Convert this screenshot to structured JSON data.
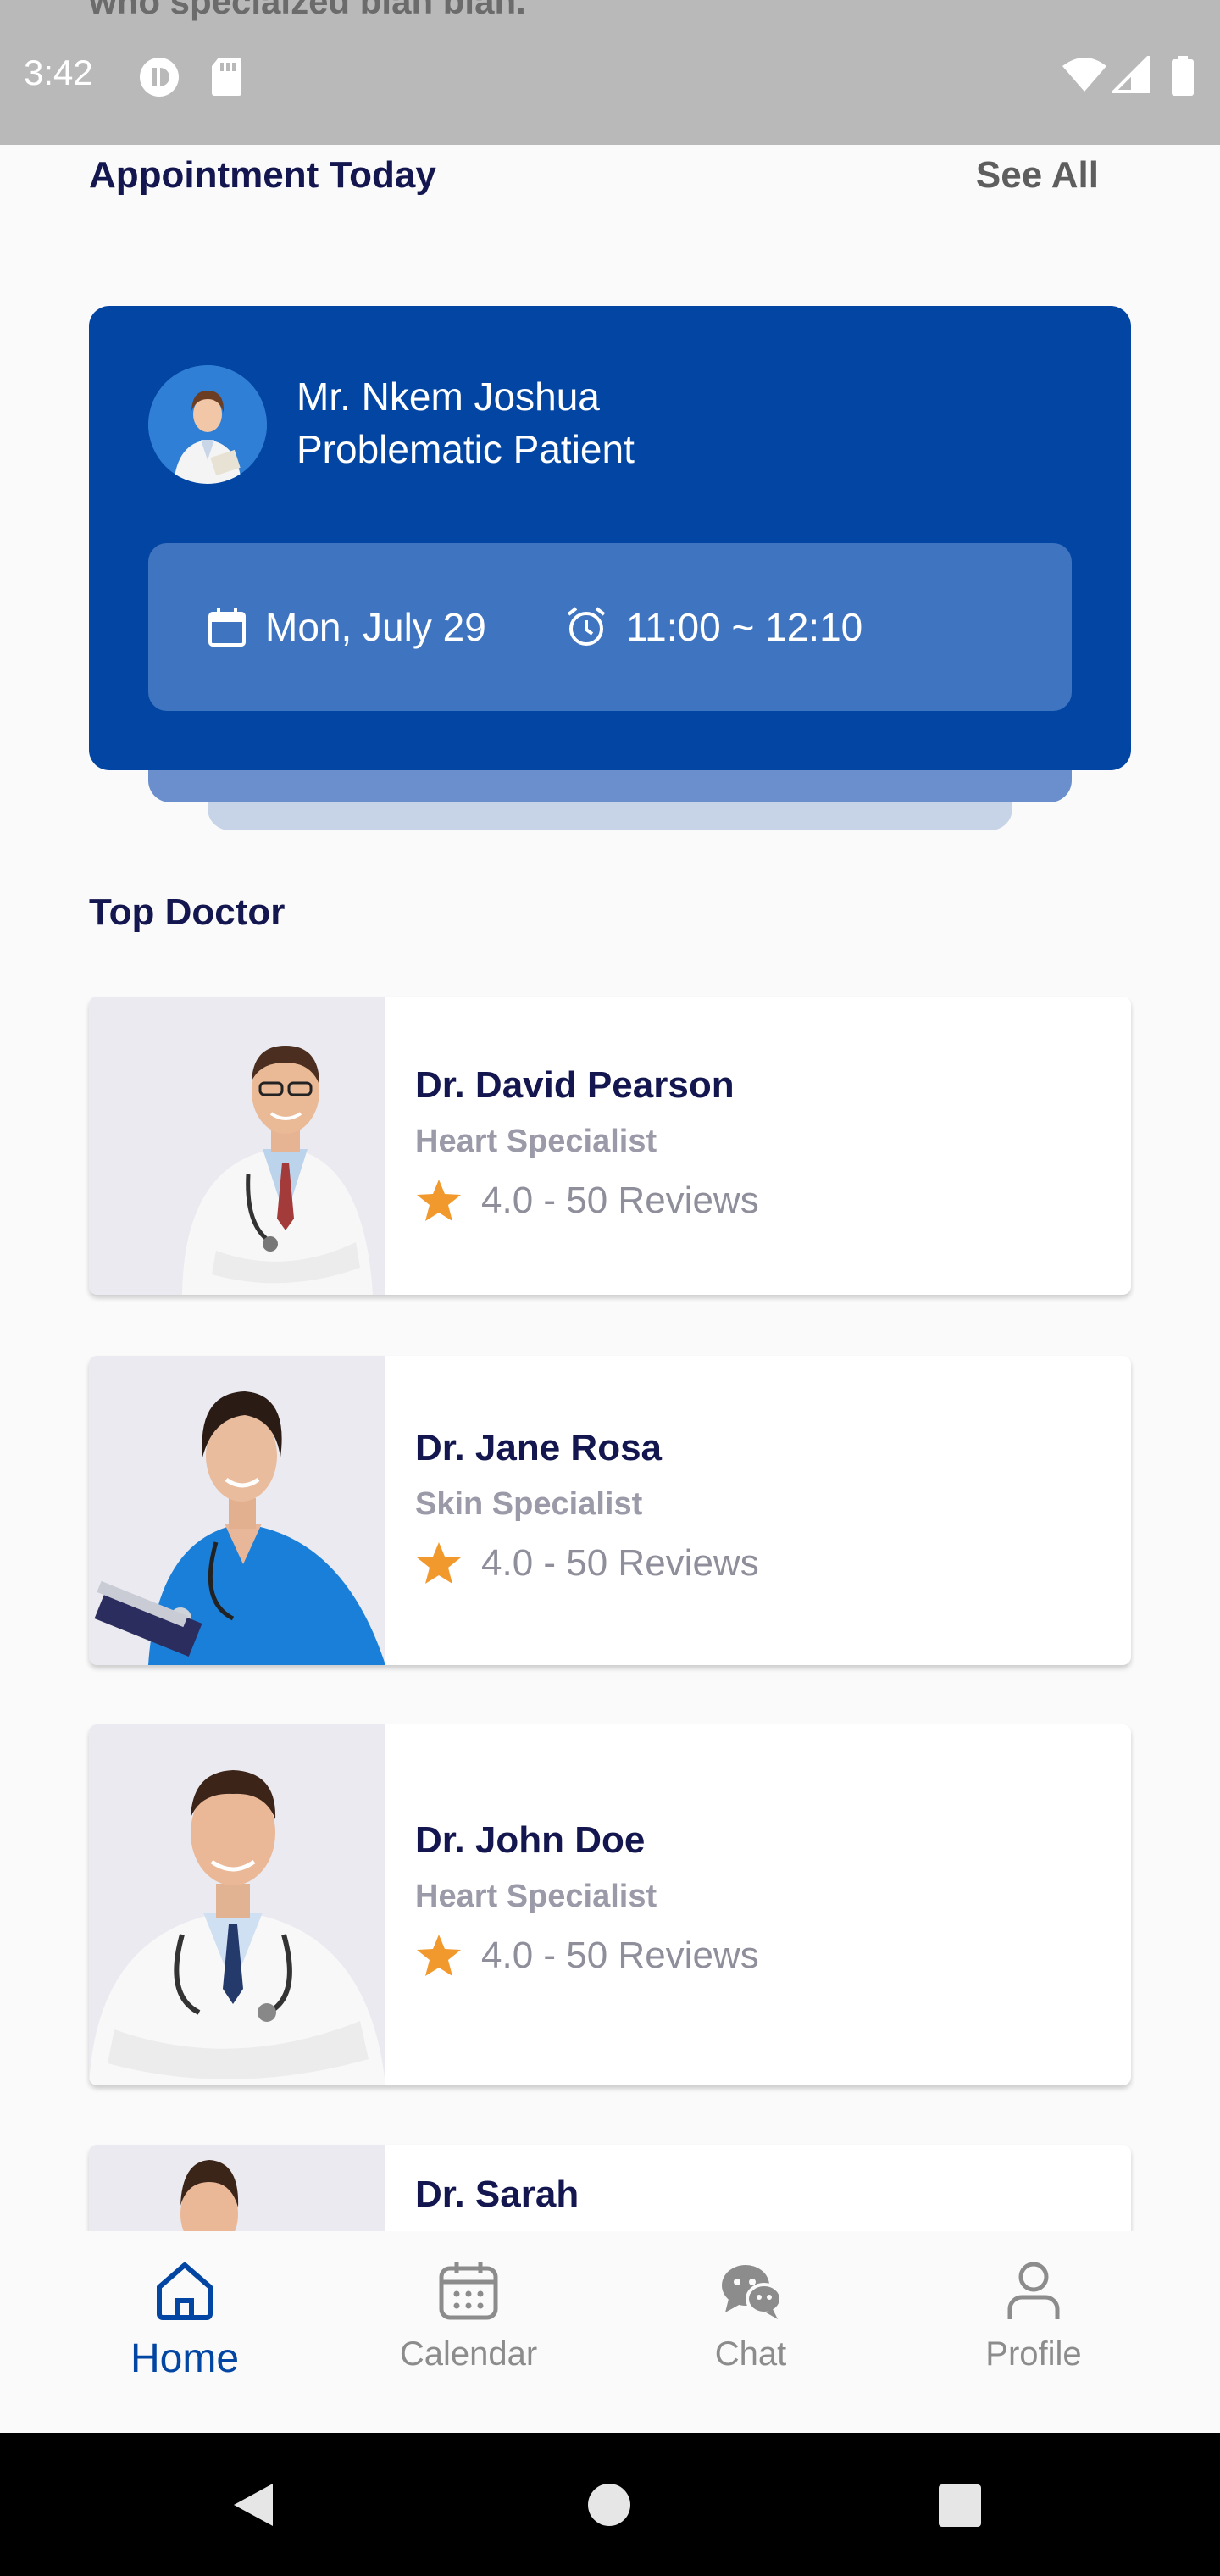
{
  "status_bar": {
    "time": "3:42",
    "peek_text": "who specialzed blah blah."
  },
  "appointment": {
    "section_title": "Appointment Today",
    "see_all": "See All",
    "patient_name": "Mr. Nkem Joshua",
    "patient_subtitle": "Problematic Patient",
    "date": "Mon, July 29",
    "time": "11:00 ~ 12:10",
    "card_color": "#0345a3"
  },
  "top_doctor": {
    "section_title": "Top Doctor",
    "doctors": [
      {
        "name": "Dr. David Pearson",
        "specialty": "Heart Specialist",
        "rating": "4.0 - 50 Reviews"
      },
      {
        "name": "Dr. Jane Rosa",
        "specialty": "Skin Specialist",
        "rating": "4.0 - 50 Reviews"
      },
      {
        "name": "Dr. John Doe",
        "specialty": "Heart Specialist",
        "rating": "4.0 - 50 Reviews"
      },
      {
        "name": "Dr. Sarah"
      }
    ],
    "star_color": "#f2992e"
  },
  "bottom_nav": {
    "items": [
      {
        "label": "Home",
        "icon": "home-icon",
        "active": true
      },
      {
        "label": "Calendar",
        "icon": "calendar-icon",
        "active": false
      },
      {
        "label": "Chat",
        "icon": "chat-icon",
        "active": false
      },
      {
        "label": "Profile",
        "icon": "profile-icon",
        "active": false
      }
    ]
  }
}
